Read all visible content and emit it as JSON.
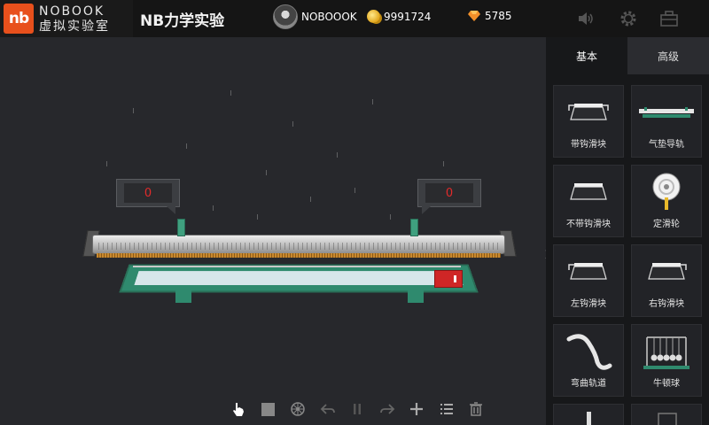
{
  "brand": {
    "mark": "nb",
    "name_en": "NOBOOK",
    "name_cn": "虚拟实验室"
  },
  "app_title": "NB力学实验",
  "user": {
    "name": "NOBOOOK",
    "coins": "9991724",
    "gems": "5785"
  },
  "top_icons": [
    "sound-icon",
    "gear-icon",
    "toolbox-icon"
  ],
  "readouts": {
    "left": "0",
    "right": "0"
  },
  "toolbar": [
    "pointer-hand-icon",
    "stop-icon",
    "wheel-icon",
    "undo-icon",
    "pause-icon",
    "redo-icon",
    "add-icon",
    "list-icon",
    "trash-icon"
  ],
  "panel": {
    "tabs": [
      {
        "label": "基本",
        "active": true
      },
      {
        "label": "高级",
        "active": false
      }
    ],
    "items": [
      {
        "label": "带钩滑块",
        "icon": "hooked-slider-icon"
      },
      {
        "label": "气垫导轨",
        "icon": "air-track-icon"
      },
      {
        "label": "不带钩滑块",
        "icon": "slider-no-hook-icon"
      },
      {
        "label": "定滑轮",
        "icon": "fixed-pulley-icon"
      },
      {
        "label": "左钩滑块",
        "icon": "left-hook-slider-icon"
      },
      {
        "label": "右钩滑块",
        "icon": "right-hook-slider-icon"
      },
      {
        "label": "弯曲轨道",
        "icon": "curved-track-icon"
      },
      {
        "label": "牛顿球",
        "icon": "newton-cradle-icon"
      }
    ]
  },
  "colors": {
    "brand": "#e8501c",
    "readout_text": "#e12b2b",
    "frame": "#2f8a6e",
    "switch": "#cf2626"
  }
}
